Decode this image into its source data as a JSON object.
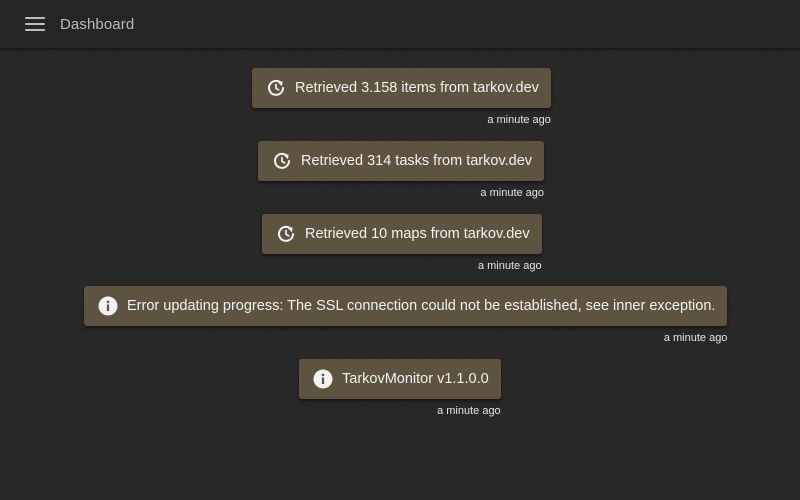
{
  "header": {
    "title": "Dashboard",
    "menu_icon": "hamburger-menu-icon"
  },
  "messages": [
    {
      "icon": "refresh-icon",
      "text": "Retrieved 3.158 items from tarkov.dev",
      "time": "a minute ago"
    },
    {
      "icon": "refresh-icon",
      "text": "Retrieved 314 tasks from tarkov.dev",
      "time": "a minute ago"
    },
    {
      "icon": "refresh-icon",
      "text": "Retrieved 10 maps from tarkov.dev",
      "time": "a minute ago"
    },
    {
      "icon": "info-icon",
      "text": "Error updating progress: The SSL connection could not be established, see inner exception.",
      "time": "a minute ago"
    },
    {
      "icon": "info-icon",
      "text": "TarkovMonitor v1.1.0.0",
      "time": "a minute ago"
    }
  ],
  "colors": {
    "background": "#272727",
    "card": "#5d5340",
    "text": "#f2f2f2"
  }
}
